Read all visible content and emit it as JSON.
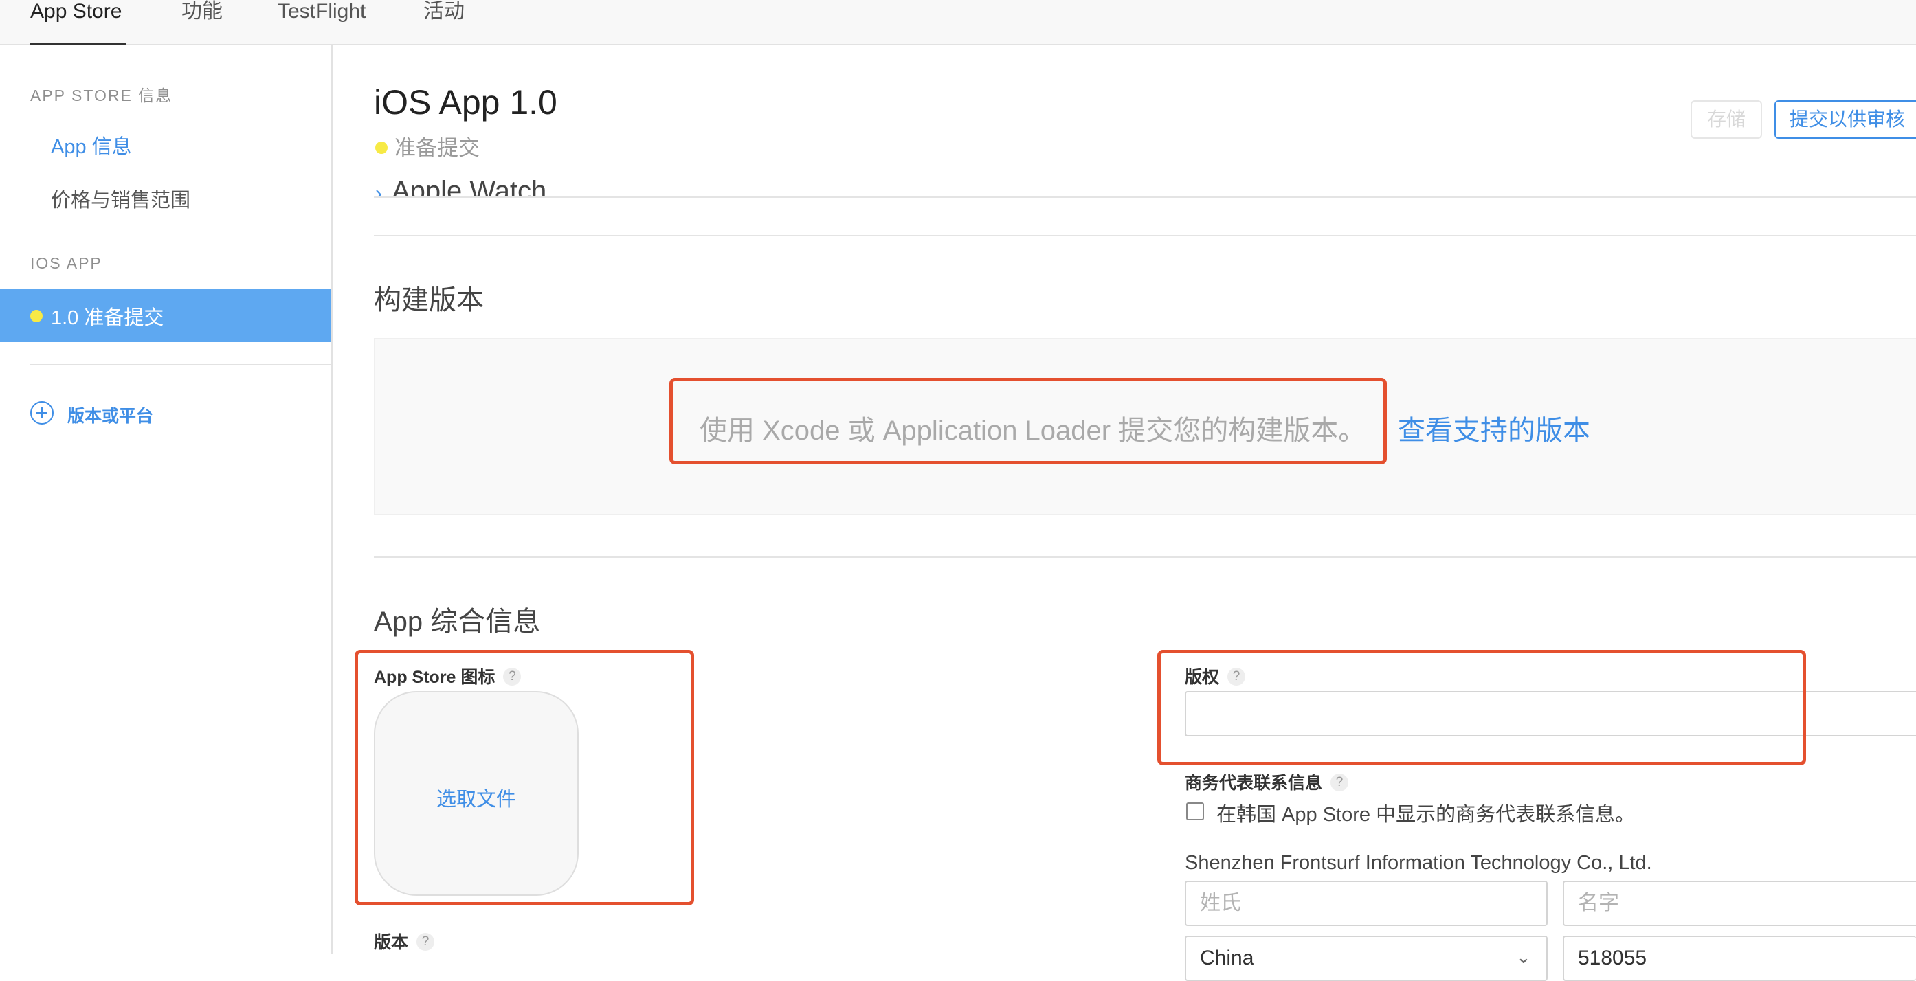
{
  "topnav": {
    "tabs": [
      {
        "label": "App Store",
        "active": true
      },
      {
        "label": "功能"
      },
      {
        "label": "TestFlight"
      },
      {
        "label": "活动"
      }
    ]
  },
  "sidebar": {
    "section_store": "APP STORE 信息",
    "items": [
      {
        "label": "App 信息"
      },
      {
        "label": "价格与销售范围"
      }
    ],
    "section_ios": "IOS APP",
    "selected_item": "1.0 准备提交",
    "add_label": "版本或平台"
  },
  "header": {
    "title": "iOS App 1.0",
    "status": "准备提交",
    "save_label": "存储",
    "submit_label": "提交以供审核"
  },
  "watch": {
    "label": "Apple Watch"
  },
  "build": {
    "title": "构建版本",
    "text": "使用 Xcode 或 Application Loader 提交您的构建版本。",
    "link": "查看支持的版本"
  },
  "general": {
    "title": "App 综合信息",
    "icon_label": "App Store 图标",
    "choose_file": "选取文件",
    "version_label": "版本",
    "copyright_label": "版权",
    "rep_label": "商务代表联系信息",
    "korea_checkbox": "在韩国 App Store 中显示的商务代表联系信息。",
    "company": "Shenzhen Frontsurf Information Technology Co., Ltd.",
    "last_name_placeholder": "姓氏",
    "first_name_placeholder": "名字",
    "country": "China",
    "postal": "518055",
    "help_glyph": "?"
  },
  "colors": {
    "accent": "#3f8ee6",
    "selected_bg": "#5ea8f1",
    "status_dot": "#f7ea45",
    "highlight": "#e4502f"
  }
}
